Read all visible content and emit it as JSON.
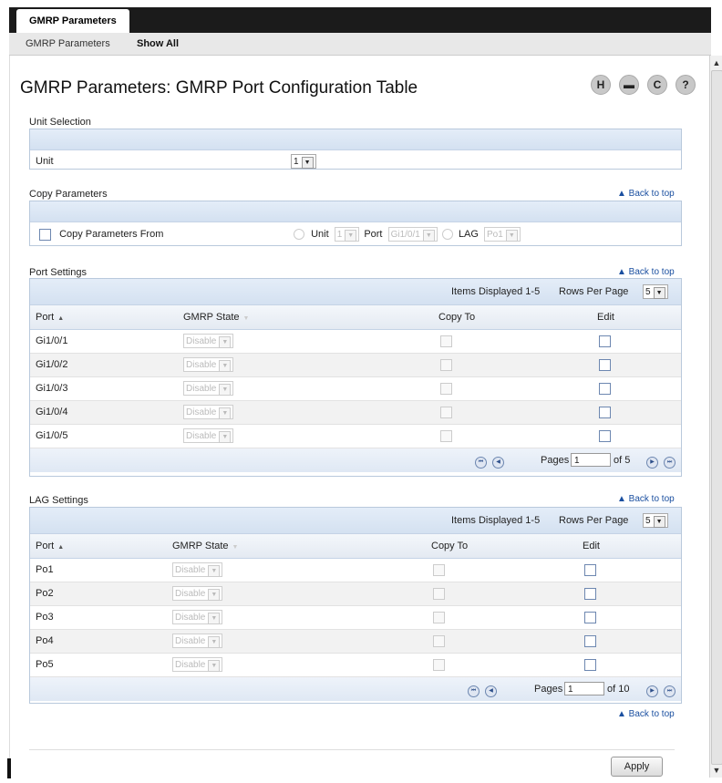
{
  "topbar": {
    "tab_label": "GMRP Parameters"
  },
  "subnav": {
    "item1": "GMRP Parameters",
    "item2": "Show All"
  },
  "page": {
    "title": "GMRP Parameters: GMRP Port Configuration Table"
  },
  "toolbar_icons": [
    "save-icon",
    "print-icon",
    "refresh-icon",
    "help-icon"
  ],
  "toolbar_glyphs": {
    "save": "H",
    "print": "▬",
    "refresh": "C",
    "help": "?"
  },
  "back_to_top": "▲ Back to top",
  "unit_selection": {
    "heading": "Unit Selection",
    "label": "Unit",
    "value": "1"
  },
  "copy_parameters": {
    "heading": "Copy Parameters",
    "label": "Copy Parameters From",
    "unit_label": "Unit",
    "unit_value": "1",
    "port_label": "Port",
    "port_value": "Gi1/0/1",
    "lag_label": "LAG",
    "lag_value": "Po1"
  },
  "port_settings": {
    "heading": "Port Settings",
    "items_displayed": "Items Displayed 1-5",
    "rows_per_page_label": "Rows Per Page",
    "rows_per_page_value": "5",
    "columns": {
      "port": "Port",
      "gmrp_state": "GMRP State",
      "copy_to": "Copy To",
      "edit": "Edit"
    },
    "rows": [
      {
        "port": "Gi1/0/1",
        "state": "Disable"
      },
      {
        "port": "Gi1/0/2",
        "state": "Disable"
      },
      {
        "port": "Gi1/0/3",
        "state": "Disable"
      },
      {
        "port": "Gi1/0/4",
        "state": "Disable"
      },
      {
        "port": "Gi1/0/5",
        "state": "Disable"
      }
    ],
    "pages_label": "Pages",
    "page_value": "1",
    "of_label": "of 5"
  },
  "lag_settings": {
    "heading": "LAG Settings",
    "items_displayed": "Items Displayed 1-5",
    "rows_per_page_label": "Rows Per Page",
    "rows_per_page_value": "5",
    "columns": {
      "port": "Port",
      "gmrp_state": "GMRP State",
      "copy_to": "Copy To",
      "edit": "Edit"
    },
    "rows": [
      {
        "port": "Po1",
        "state": "Disable"
      },
      {
        "port": "Po2",
        "state": "Disable"
      },
      {
        "port": "Po3",
        "state": "Disable"
      },
      {
        "port": "Po4",
        "state": "Disable"
      },
      {
        "port": "Po5",
        "state": "Disable"
      }
    ],
    "pages_label": "Pages",
    "page_value": "1",
    "of_label": "of 10"
  },
  "apply_label": "Apply"
}
